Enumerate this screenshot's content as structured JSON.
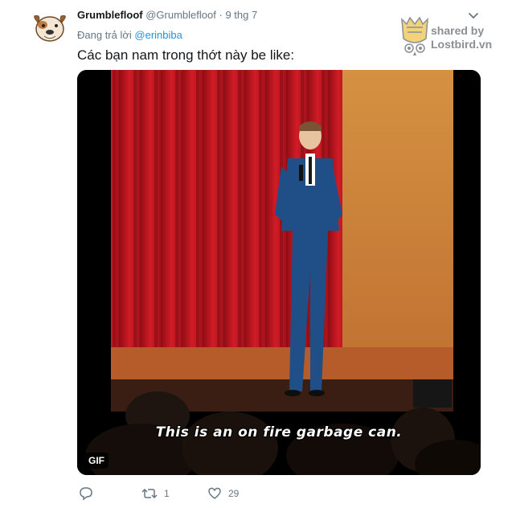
{
  "tweet": {
    "display_name": "Grumblefloof",
    "handle": "@Grumblefloof",
    "separator": "·",
    "date": "9 thg 7",
    "reply_prefix": "Đang trả lời",
    "reply_mention": "@erinbiba",
    "text": "Các bạn nam trong thớt này be like:"
  },
  "watermark": {
    "line1": "shared by",
    "line2": "Lostbird.vn"
  },
  "media": {
    "subtitle": "This is an on fire garbage can.",
    "badge": "GIF"
  },
  "actions": {
    "reply_icon": "reply-icon",
    "retweet_icon": "retweet-icon",
    "retweet_count": "1",
    "like_icon": "heart-icon",
    "like_count": "29"
  },
  "colors": {
    "link": "#1b95e0",
    "muted": "#657786",
    "curtain": "#c0161f",
    "stage_wall": "#d08a3a"
  }
}
